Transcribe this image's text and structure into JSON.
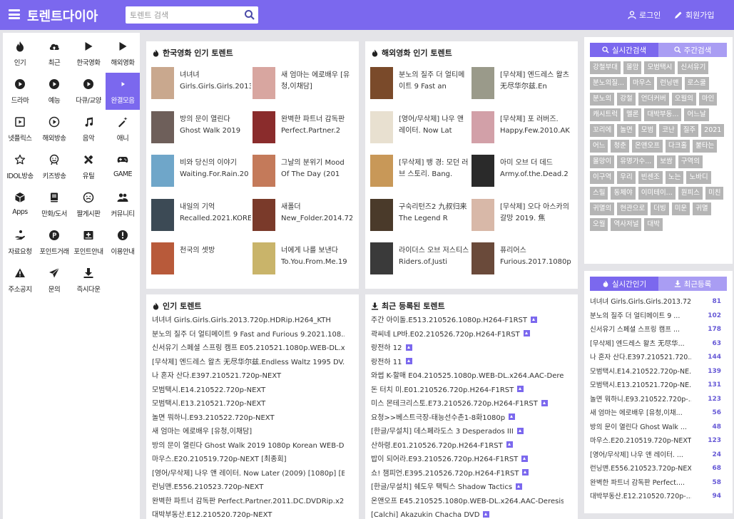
{
  "header": {
    "logo": "토렌트다이아",
    "search_placeholder": "토렌트 검색",
    "login": "로그인",
    "signup": "회원가입"
  },
  "nav": [
    {
      "label": "인기",
      "icon": "fire-icon"
    },
    {
      "label": "최근",
      "icon": "cloud-upload-icon"
    },
    {
      "label": "한국영화",
      "icon": "play-icon"
    },
    {
      "label": "해외영화",
      "icon": "play-icon"
    },
    {
      "label": "드라마",
      "icon": "play-circle-icon"
    },
    {
      "label": "예능",
      "icon": "play-circle-icon"
    },
    {
      "label": "다큐/교양",
      "icon": "play-circle-icon"
    },
    {
      "label": "완결모음",
      "icon": "play-circle-icon"
    },
    {
      "label": "넷플릭스",
      "icon": "play-square-icon"
    },
    {
      "label": "해외방송",
      "icon": "play-circle-outline-icon"
    },
    {
      "label": "음악",
      "icon": "music-note-icon"
    },
    {
      "label": "애니",
      "icon": "magic-wand-icon"
    },
    {
      "label": "IDOL방송",
      "icon": "star-icon"
    },
    {
      "label": "키즈방송",
      "icon": "kids-icon"
    },
    {
      "label": "유틸",
      "icon": "tools-icon"
    },
    {
      "label": "GAME",
      "icon": "gamepad-icon"
    },
    {
      "label": "Apps",
      "icon": "cube-icon"
    },
    {
      "label": "만화/도서",
      "icon": "book-icon"
    },
    {
      "label": "짤게시판",
      "icon": "smile-icon"
    },
    {
      "label": "커뮤니티",
      "icon": "users-icon"
    },
    {
      "label": "자료요청",
      "icon": "hand-icon"
    },
    {
      "label": "포인트거래",
      "icon": "point-icon"
    },
    {
      "label": "포인트안내",
      "icon": "card-plus-icon"
    },
    {
      "label": "이용안내",
      "icon": "info-icon"
    },
    {
      "label": "주소공지",
      "icon": "warning-icon"
    },
    {
      "label": "문의",
      "icon": "send-icon"
    },
    {
      "label": "즉시다운",
      "icon": "download-icon"
    }
  ],
  "korean_movies": {
    "title": "한국영화 인기 토렌트",
    "items": [
      {
        "text": "녀녀녀 Girls.Girls.Girls.2013.720p.HDRi",
        "color": "#c9a88e"
      },
      {
        "text": "새 엄마는 에로배우 [유청,이채담]",
        "color": "#d8a6a0"
      },
      {
        "text": "방의 문이 열린다 Ghost Walk 2019 10",
        "color": "#6e5f5a"
      },
      {
        "text": "완벽한 파트너 감독판 Perfect.Partner.2",
        "color": "#8a2c2c"
      },
      {
        "text": "비와 당신의 이야기 Waiting.For.Rain.20",
        "color": "#6fa6c9"
      },
      {
        "text": "그날의 분위기 Mood Of The Day (201",
        "color": "#c47a5a"
      },
      {
        "text": "내일의 기억 Recalled.2021.KOREAN.10",
        "color": "#3c4a55"
      },
      {
        "text": "새폴더 New_Folder.2014.720p.HDRip.H",
        "color": "#7a3a2a"
      },
      {
        "text": "천국의 셋방",
        "color": "#b85a3a"
      },
      {
        "text": "너에게 나를 보낸다 To.You.From.Me.19",
        "color": "#c9b46a"
      }
    ]
  },
  "foreign_movies": {
    "title": "해외영화 인기 토렌트",
    "items": [
      {
        "text": "분노의 질주 더 얼티메이트 9 Fast an",
        "color": "#7a4a2a"
      },
      {
        "text": "[무삭제] 엔드레스 왈츠 无尽华尔兹.En",
        "color": "#9a9a8a"
      },
      {
        "text": "[영어/무삭제] 나우 앤 레이터. Now Lat",
        "color": "#e8e0d0"
      },
      {
        "text": "[무삭제] 포 러버즈. Happy.Few.2010.AK",
        "color": "#d2a0a8"
      },
      {
        "text": "[무삭제] 뱅 경: 모던 러브 스토리. Bang.",
        "color": "#c89858"
      },
      {
        "text": "아미 오브 더 데드 Army.of.the.Dead.2",
        "color": "#2a2a2a"
      },
      {
        "text": "구숙리턴즈2 九叔归来 The Legend R",
        "color": "#4a3a2a"
      },
      {
        "text": "[무삭제] 오다 아스카의 갈망 2019. 焦",
        "color": "#d8b8a8"
      },
      {
        "text": "라이더스 오브 저스티스 Riders.of.Justi",
        "color": "#3a3a3a"
      },
      {
        "text": "퓨리어스 Furious.2017.1080p.BluRay.x",
        "color": "#6a4a3a"
      }
    ]
  },
  "popular": {
    "title": "인기 토렌트",
    "items": [
      "녀녀녀 Girls.Girls.Girls.2013.720p.HDRip.H264_KTH",
      "분노의 질주 더 얼티메이트 9 Fast and Furious 9.2021.108...",
      "신서유기 스페셜 스프링 캠프 E05.210521.1080p.WEB-DL.x...",
      "[무삭제] 엔드레스 왈츠 无尽华尔兹.Endless Waltz 1995 DV...",
      "나 혼자 산다.E397.210521.720p-NEXT",
      "모범택시.E14.210522.720p-NEXT",
      "모범택시.E13.210521.720p-NEXT",
      "놀면 뭐하니.E93.210522.720p-NEXT",
      "새 엄마는 에로배우 [유청,이채담]",
      "방의 문이 열린다 Ghost Walk 2019 1080p Korean WEB-D...",
      "마우스.E20.210519.720p-NEXT [최종회]",
      "[영어/무삭제] 나우 앤 레이터. Now Later (2009) [1080p] [B...",
      "런닝맨.E556.210523.720p-NEXT",
      "완벽한 파트너 감독판 Perfect.Partner.2011.DC.DVDRip.x26...",
      "대박부동산.E12.210520.720p-NEXT"
    ]
  },
  "recent": {
    "title": "최근 등록된 토렌트",
    "items": [
      "주간 아이돌.E513.210526.1080p.H264-F1RST",
      "곽씨네 LP바.E02.210526.720p.H264-F1RST",
      "랑전하 12",
      "랑전하 11",
      "와썹 K-할매 E04.210525.1080p.WEB-DL.x264.AAC-Deresisi",
      "돈 터치 미.E01.210526.720p.H264-F1RST",
      "미스 몬테크리스토.E73.210526.720p.H264-F1RST",
      "요청>>베스트극장-태능선수촌1-8화1080p",
      "[한글/무설치] 데스페라도스 3 Desperados III",
      "산하령.E01.210526.720p.H264-F1RST",
      "밥이 되어라.E93.210526.720p.H264-F1RST",
      "쇼! 챔피언.E395.210526.720p.H264-F1RST",
      "[한글/무설치] 쉐도우 택틱스 Shadow Tactics",
      "온앤오프 E45.210525.1080p.WEB-DL.x264.AAC-Deresisi",
      "[Calchi] Akazukin Chacha DVD"
    ]
  },
  "search_tabs": {
    "realtime": "실시간검색",
    "weekly": "주간검색"
  },
  "tags": [
    "강철부대",
    "몰맘",
    "모범택시",
    "신서유기",
    "분노의질...",
    "마우스",
    "런닝맨",
    "로스쿨",
    "분노의",
    "강철",
    "언더커버",
    "오월의",
    "마인",
    "캐시트럭",
    "멜론",
    "대박부동...",
    "어느날",
    "꼬리에",
    "놀면",
    "모범",
    "코난",
    "질주",
    "2021",
    "어느",
    "청춘",
    "온앤오프",
    "다크홀",
    "불타는",
    "몰망이",
    "유명가수...",
    "보쌈",
    "구역의",
    "이구역",
    "우리",
    "빈센조",
    "노는",
    "노바디",
    "스릴",
    "동체야",
    "이미테이...",
    "원피스",
    "미친",
    "귀멸의",
    "현관으로",
    "더빙",
    "미운",
    "귀멸",
    "오월",
    "역사저널",
    "대박"
  ],
  "rank_tabs": {
    "popular": "실시간인기",
    "recent": "최근등록"
  },
  "ranks": [
    {
      "text": "녀녀녀 Girls.Girls.Girls.2013.72...",
      "count": "81"
    },
    {
      "text": "분노의 질주 더 얼티메이트 9 ...",
      "count": "102"
    },
    {
      "text": "신서유기 스페셜 스프링 캠프 ...",
      "count": "178"
    },
    {
      "text": "[무삭제] 엔드레스 왈츠 无尽华...",
      "count": "63"
    },
    {
      "text": "나 혼자 산다.E397.210521.720...",
      "count": "144"
    },
    {
      "text": "모범택시.E14.210522.720p-NE...",
      "count": "139"
    },
    {
      "text": "모범택시.E13.210521.720p-NE...",
      "count": "131"
    },
    {
      "text": "놀면 뭐하니.E93.210522.720p-...",
      "count": "123"
    },
    {
      "text": "새 엄마는 에로배우 [유청,이채...",
      "count": "56"
    },
    {
      "text": "방의 문이 열린다 Ghost Walk ...",
      "count": "48"
    },
    {
      "text": "마우스.E20.210519.720p-NEXT...",
      "count": "123"
    },
    {
      "text": "[영어/무삭제] 나우 앤 레이터. ...",
      "count": "24"
    },
    {
      "text": "런닝맨.E556.210523.720p-NEXT",
      "count": "68"
    },
    {
      "text": "완벽한 파트너 감독판 Perfect....",
      "count": "58"
    },
    {
      "text": "대박부동산.E12.210520.720p-...",
      "count": "94"
    }
  ],
  "colors": {
    "accent": "#7b68ee",
    "accent_light": "#a99df3",
    "tag_bg": "#b5b5b5",
    "count": "#6659d6"
  }
}
